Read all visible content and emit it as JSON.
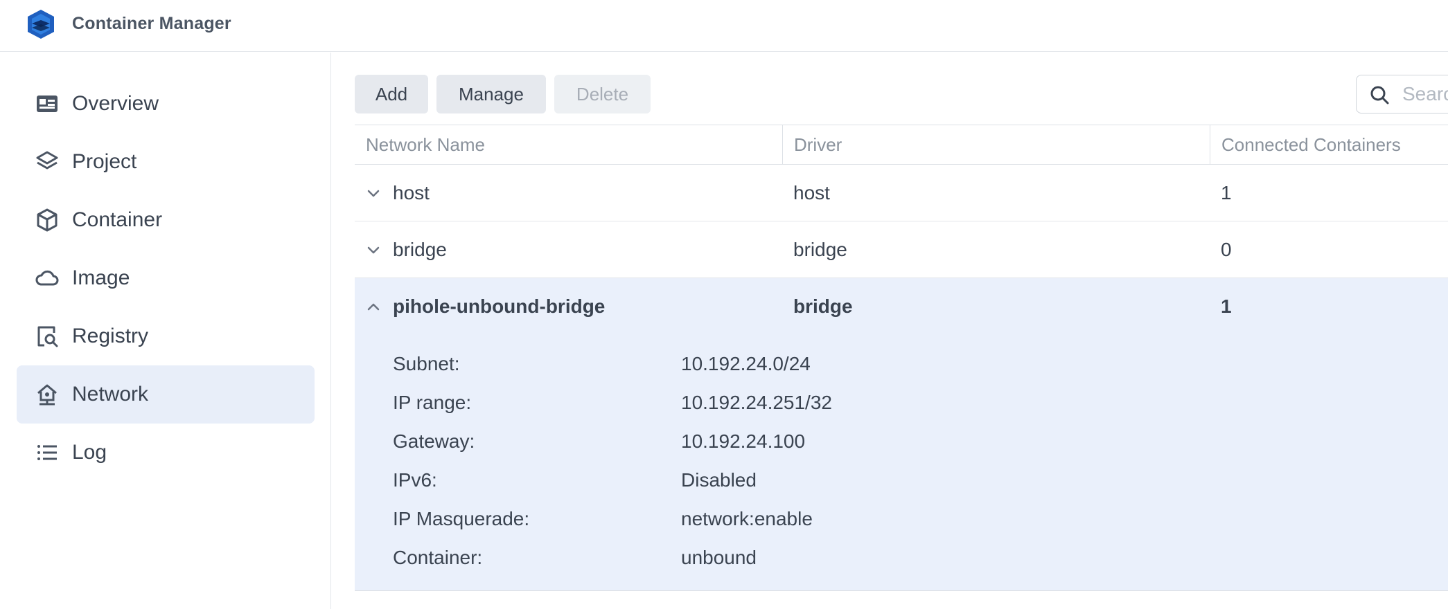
{
  "app": {
    "title": "Container Manager"
  },
  "sidebar": {
    "items": [
      {
        "label": "Overview",
        "icon": "overview-card-icon",
        "active": false
      },
      {
        "label": "Project",
        "icon": "layers-icon",
        "active": false
      },
      {
        "label": "Container",
        "icon": "cube-icon",
        "active": false
      },
      {
        "label": "Image",
        "icon": "cloud-icon",
        "active": false
      },
      {
        "label": "Registry",
        "icon": "registry-search-icon",
        "active": false
      },
      {
        "label": "Network",
        "icon": "network-house-icon",
        "active": true
      },
      {
        "label": "Log",
        "icon": "list-icon",
        "active": false
      }
    ]
  },
  "toolbar": {
    "add_label": "Add",
    "manage_label": "Manage",
    "delete_label": "Delete",
    "search_placeholder": "Search"
  },
  "table": {
    "columns": [
      "Network Name",
      "Driver",
      "Connected Containers"
    ],
    "rows": [
      {
        "name": "host",
        "driver": "host",
        "connected": "1",
        "expanded": false
      },
      {
        "name": "bridge",
        "driver": "bridge",
        "connected": "0",
        "expanded": false
      },
      {
        "name": "pihole-unbound-bridge",
        "driver": "bridge",
        "connected": "1",
        "expanded": true
      }
    ],
    "details": [
      {
        "label": "Subnet:",
        "value": "10.192.24.0/24"
      },
      {
        "label": "IP range:",
        "value": "10.192.24.251/32"
      },
      {
        "label": "Gateway:",
        "value": "10.192.24.100"
      },
      {
        "label": "IPv6:",
        "value": "Disabled"
      },
      {
        "label": "IP Masquerade:",
        "value": "network:enable"
      },
      {
        "label": "Container:",
        "value": "unbound"
      }
    ]
  },
  "colors": {
    "active_bg": "#e8eef9",
    "accent": "#1f5fbf"
  }
}
